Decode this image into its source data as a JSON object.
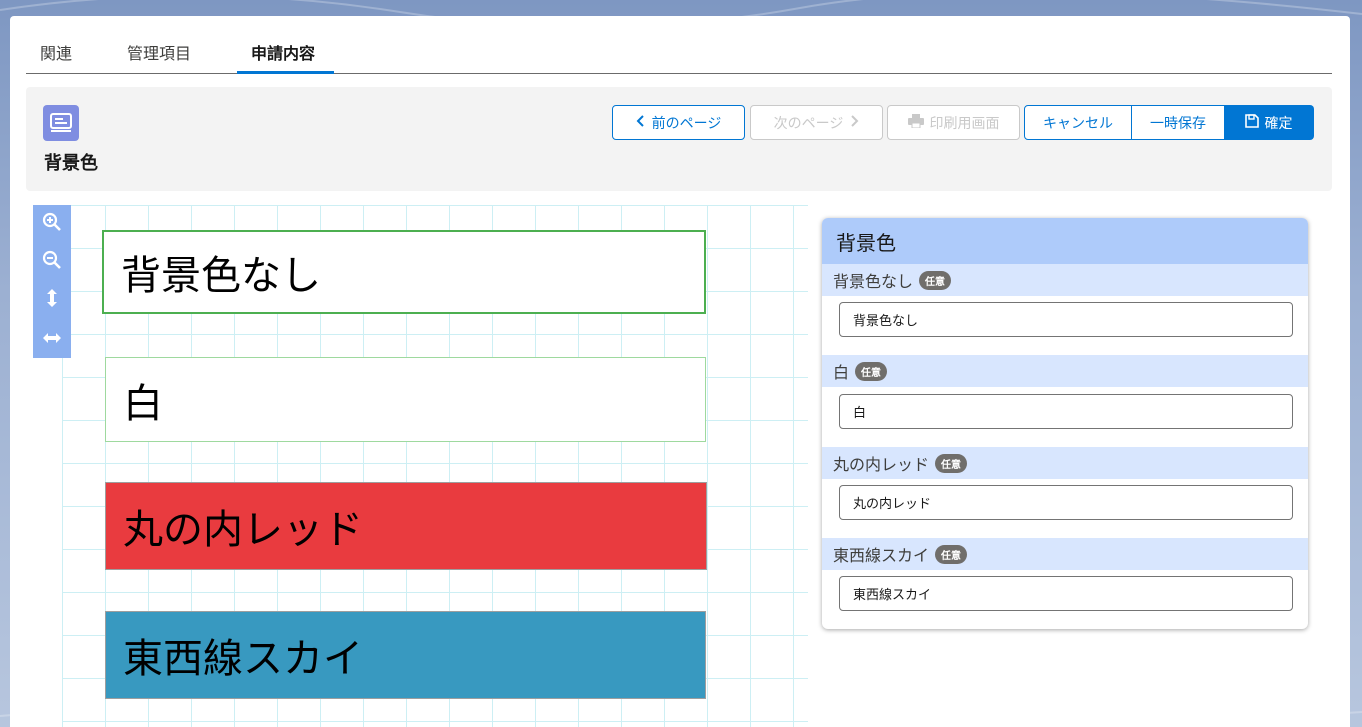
{
  "tabs": [
    {
      "label": "関連"
    },
    {
      "label": "管理項目"
    },
    {
      "label": "申請内容"
    }
  ],
  "header": {
    "title": "背景色",
    "icon": "form-icon",
    "accent": "#0176d3"
  },
  "toolbar": {
    "prev_label": "前のページ",
    "next_label": "次のページ",
    "print_label": "印刷用画面",
    "cancel_label": "キャンセル",
    "save_draft_label": "一時保存",
    "confirm_label": "確定"
  },
  "canvas": {
    "fields": [
      {
        "text": "背景色なし",
        "background": "#ffffff",
        "border": "#4caf50"
      },
      {
        "text": "白",
        "background": "#ffffff",
        "border": "#9ed99e"
      },
      {
        "text": "丸の内レッド",
        "background": "#e93b3f",
        "border": "#9e9e9e"
      },
      {
        "text": "東西線スカイ",
        "background": "#3899c0",
        "border": "#9e9e9e"
      }
    ]
  },
  "side_panel": {
    "title": "背景色",
    "badge": "任意",
    "items": [
      {
        "label": "背景色なし",
        "value": "背景色なし"
      },
      {
        "label": "白",
        "value": "白"
      },
      {
        "label": "丸の内レッド",
        "value": "丸の内レッド"
      },
      {
        "label": "東西線スカイ",
        "value": "東西線スカイ"
      }
    ]
  }
}
